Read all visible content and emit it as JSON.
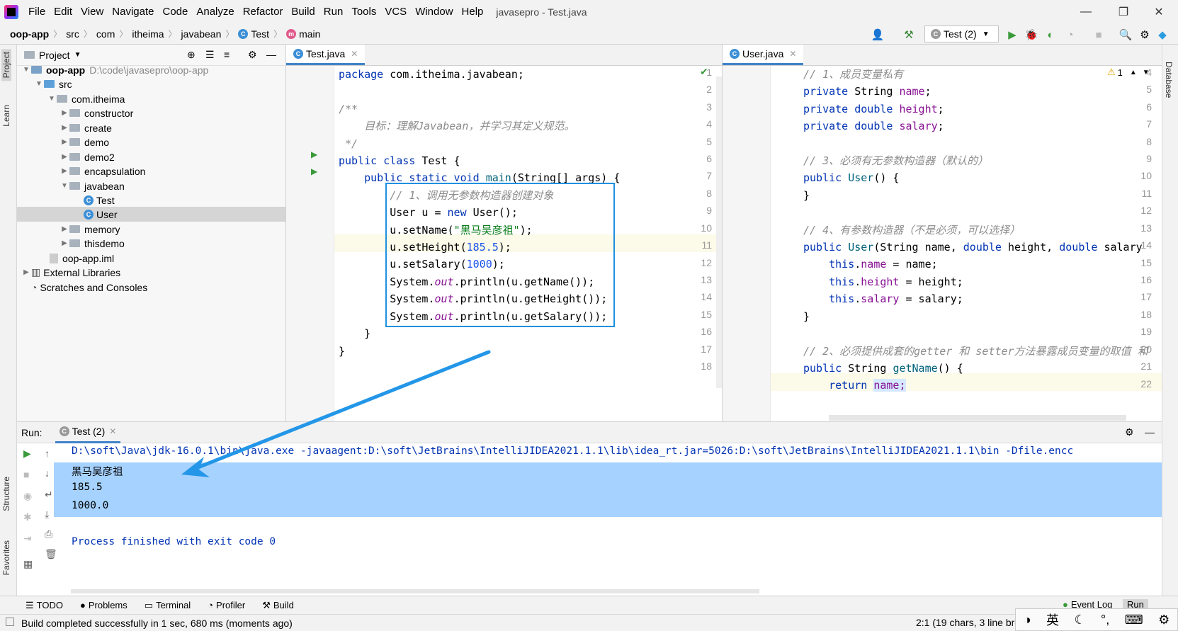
{
  "menu": [
    "File",
    "Edit",
    "View",
    "Navigate",
    "Code",
    "Analyze",
    "Refactor",
    "Build",
    "Run",
    "Tools",
    "VCS",
    "Window",
    "Help"
  ],
  "window_title": "javasepro - Test.java",
  "breadcrumb": [
    "oop-app",
    "src",
    "com",
    "itheima",
    "javabean",
    "Test",
    "main"
  ],
  "run_config": "Test (2)",
  "project_panel": {
    "title": "Project",
    "tree": [
      {
        "label": "oop-app",
        "path": "D:\\code\\javasepro\\oop-app"
      },
      {
        "label": "src"
      },
      {
        "label": "com.itheima"
      },
      {
        "label": "constructor"
      },
      {
        "label": "create"
      },
      {
        "label": "demo"
      },
      {
        "label": "demo2"
      },
      {
        "label": "encapsulation"
      },
      {
        "label": "javabean"
      },
      {
        "label": "Test"
      },
      {
        "label": "User"
      },
      {
        "label": "memory"
      },
      {
        "label": "thisdemo"
      },
      {
        "label": "oop-app.iml"
      },
      {
        "label": "External Libraries"
      },
      {
        "label": "Scratches and Consoles"
      }
    ]
  },
  "left_strip": {
    "project": "Project",
    "learn": "Learn",
    "structure": "Structure",
    "favorites": "Favorites"
  },
  "right_strip": {
    "database": "Database"
  },
  "editor_left": {
    "tab": "Test.java",
    "line_numbers": [
      "1",
      "2",
      "3",
      "4",
      "5",
      "6",
      "7",
      "8",
      "9",
      "10",
      "11",
      "12",
      "13",
      "14",
      "15",
      "16",
      "17",
      "18"
    ]
  },
  "editor_right": {
    "tab": "User.java",
    "warning_count": "1",
    "line_numbers": [
      "4",
      "5",
      "6",
      "7",
      "8",
      "9",
      "10",
      "11",
      "12",
      "13",
      "14",
      "15",
      "16",
      "17",
      "18",
      "19",
      "20",
      "21",
      "22"
    ]
  },
  "run_panel": {
    "label": "Run:",
    "tab": "Test (2)",
    "output": [
      "D:\\soft\\Java\\jdk-16.0.1\\bin\\java.exe -javaagent:D:\\soft\\JetBrains\\IntelliJIDEA2021.1.1\\lib\\idea_rt.jar=5026:D:\\soft\\JetBrains\\IntelliJIDEA2021.1.1\\bin -Dfile.encc",
      "黑马吴彦祖",
      "185.5",
      "1000.0",
      "",
      "Process finished with exit code 0"
    ]
  },
  "bottom_tabs": [
    "TODO",
    "Problems",
    "Terminal",
    "Profiler",
    "Build",
    "Event Log",
    "Run"
  ],
  "status": {
    "message": "Build completed successfully in 1 sec, 680 ms (moments ago)",
    "position": "2:1 (19 chars, 3 line bre"
  },
  "ime": [
    "英",
    "☾",
    "°,",
    "⌨",
    "⚙"
  ]
}
